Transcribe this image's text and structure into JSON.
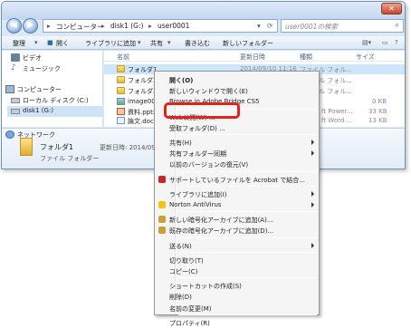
{
  "address": {
    "crumbs": [
      "コンピューター",
      "disk1 (G:)",
      "user0001"
    ],
    "search_placeholder": "user0001の検索"
  },
  "toolbar": {
    "items": [
      "整理",
      "開く",
      "ライブラリに追加",
      "共有",
      "書き込む",
      "新しいフォルダー"
    ]
  },
  "sidebar": {
    "items": [
      {
        "label": "ビデオ",
        "icon": "video-icon"
      },
      {
        "label": "ミュージック",
        "icon": "music-icon"
      },
      {
        "label": "コンピューター",
        "icon": "computer-icon"
      },
      {
        "label": "ローカル ディスク (C:)",
        "icon": "drive-icon"
      },
      {
        "label": "disk1 (G:)",
        "icon": "usb-drive-icon"
      },
      {
        "label": "ネットワーク",
        "icon": "network-icon"
      }
    ]
  },
  "columns": {
    "name": "名前",
    "date": "更新日時",
    "type": "種類",
    "size": "サイズ"
  },
  "files": [
    {
      "name": "フォルダ1",
      "date": "2014/09/10 11:16",
      "type": "ファイル フォル...",
      "size": "",
      "icon": "folder"
    },
    {
      "name": "フォルダ2",
      "date": "",
      "type": "ファイル フォル...",
      "size": "",
      "icon": "folder"
    },
    {
      "name": "フォルダ3",
      "date": "",
      "type": "ファイル フォル...",
      "size": "",
      "icon": "folder"
    },
    {
      "name": "image001",
      "date": "",
      "type": "",
      "size": "0 KB",
      "icon": "image"
    },
    {
      "name": "資料.pptx",
      "date": "",
      "type": "ft Power...",
      "size": "33 KB",
      "icon": "ppt"
    },
    {
      "name": "論文.docx",
      "date": "",
      "type": "ft Word ...",
      "size": "13 KB",
      "icon": "doc"
    },
    {
      "name": "質問.docx",
      "date": "",
      "type": "ft Word ...",
      "size": "0 KB",
      "icon": "doc"
    }
  ],
  "details": {
    "name": "フォルダ1",
    "date_label": "更新日時: 2014/09/",
    "type": "ファイル フォルダー"
  },
  "context_menu": {
    "items": [
      {
        "label": "開く(O)",
        "bold": true
      },
      {
        "label": "新しいウィンドウで開く(E)"
      },
      {
        "label": "Browse in Adobe Bridge CS5"
      },
      {
        "sep": true
      },
      {
        "label": "Web公開(W) ..."
      },
      {
        "label": "受取フォルダ(D) ..."
      },
      {
        "sep": true
      },
      {
        "label": "共有(H)",
        "submenu": true
      },
      {
        "label": "共有フォルダー同期",
        "submenu": true
      },
      {
        "label": "以前のバージョンの復元(V)"
      },
      {
        "sep": true
      },
      {
        "label": "サポートしているファイルを Acrobat で結合...",
        "icon": "acrobat-icon",
        "color": "#c0282a"
      },
      {
        "sep": true
      },
      {
        "label": "ライブラリに追加(I)",
        "submenu": true
      },
      {
        "label": "Norton AntiVirus",
        "submenu": true,
        "icon": "norton-icon",
        "color": "#f2c40f"
      },
      {
        "sep": true
      },
      {
        "label": "新しい暗号化アーカイブに追加(A)...",
        "icon": "lock-icon",
        "color": "#c9a13b"
      },
      {
        "label": "既存の暗号化アーカイブに追加(D)...",
        "icon": "lock-icon",
        "color": "#c9a13b"
      },
      {
        "sep": true
      },
      {
        "label": "送る(N)",
        "submenu": true
      },
      {
        "sep": true
      },
      {
        "label": "切り取り(T)"
      },
      {
        "label": "コピー(C)"
      },
      {
        "sep": true
      },
      {
        "label": "ショートカットの作成(S)"
      },
      {
        "label": "削除(D)"
      },
      {
        "label": "名前の変更(M)"
      },
      {
        "sep": true
      },
      {
        "label": "プロパティ(R)"
      }
    ]
  },
  "colors": {
    "highlight": "#e2231a",
    "selection": "#cde6fb"
  }
}
